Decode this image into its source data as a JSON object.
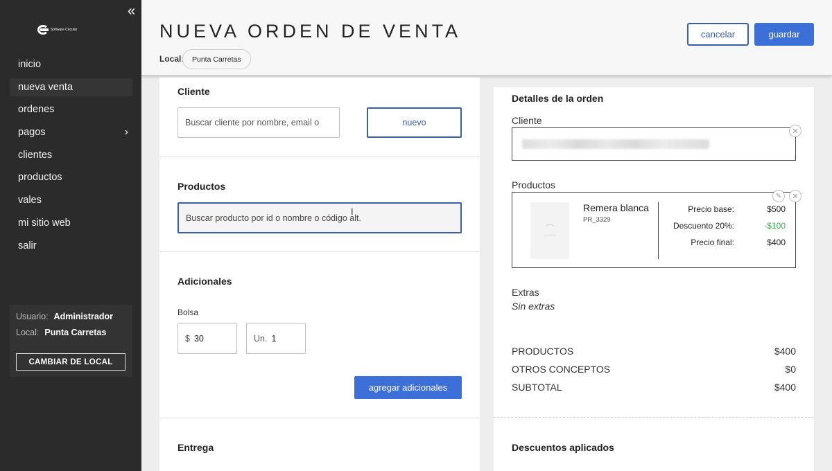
{
  "sidebar": {
    "collapse_icon": "double-chevron-left-icon",
    "logo_text": "Software Circular",
    "nav": [
      {
        "label": "inicio"
      },
      {
        "label": "nueva venta",
        "active": true
      },
      {
        "label": "ordenes"
      },
      {
        "label": "pagos",
        "has_submenu": true,
        "chevron": "›"
      },
      {
        "label": "clientes"
      },
      {
        "label": "productos"
      },
      {
        "label": "vales"
      },
      {
        "label": "mi sitio web"
      },
      {
        "label": "salir"
      }
    ],
    "user": {
      "user_label": "Usuario:",
      "user_value": "Administrador",
      "local_label": "Local:",
      "local_value": "Punta Carretas",
      "change_button": "CAMBIAR DE LOCAL"
    }
  },
  "header": {
    "title": "NUEVA ORDEN DE VENTA",
    "local_label": "Local:",
    "local_value": "Punta Carretas",
    "cancel_label": "cancelar",
    "save_label": "guardar"
  },
  "form": {
    "cliente": {
      "title": "Cliente",
      "search_placeholder": "Buscar cliente por nombre, email o",
      "new_button": "nuevo"
    },
    "productos": {
      "title": "Productos",
      "search_placeholder": "Buscar producto por id o nombre o código alt."
    },
    "adicionales": {
      "title": "Adicionales",
      "bolsa_label": "Bolsa",
      "price_prefix": "$",
      "price_value": "30",
      "units_prefix": "Un.",
      "units_value": "1",
      "add_button": "agregar adicionales"
    },
    "entrega": {
      "title": "Entrega"
    }
  },
  "details": {
    "title": "Detalles de la orden",
    "cliente_label": "Cliente",
    "productos_label": "Productos",
    "product": {
      "name": "Remera blanca",
      "code": "PR_3329",
      "thumb_brand": "LA BIEN",
      "base_label": "Precio base:",
      "base_value": "$500",
      "discount_label": "Descuento 20%:",
      "discount_value": "-$100",
      "final_label": "Precio final:",
      "final_value": "$400"
    },
    "extras_label": "Extras",
    "extras_value": "Sin extras",
    "summary": [
      {
        "label": "PRODUCTOS",
        "value": "$400"
      },
      {
        "label": "OTROS CONCEPTOS",
        "value": "$0"
      },
      {
        "label": "SUBTOTAL",
        "value": "$400"
      }
    ],
    "descuentos_title": "Descuentos aplicados"
  },
  "colors": {
    "accent": "#3d6fd9",
    "outline": "#3b5ea8",
    "sidebar_bg": "#2b2b2b",
    "discount_green": "#33b04a"
  }
}
